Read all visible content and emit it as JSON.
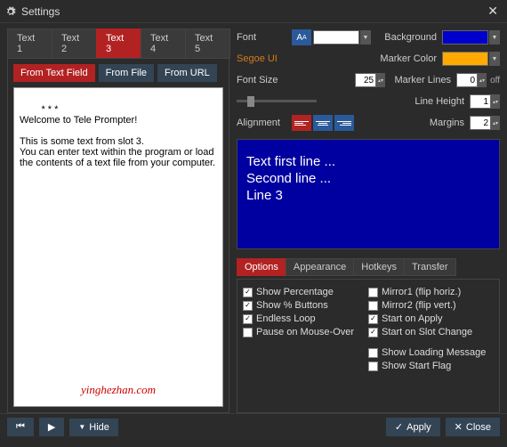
{
  "window": {
    "title": "Settings",
    "close": "✕"
  },
  "left_tabs": [
    "Text 1",
    "Text 2",
    "Text 3",
    "Text 4",
    "Text 5"
  ],
  "left_tab_active": 2,
  "src_buttons": [
    "From Text Field",
    "From File",
    "From URL"
  ],
  "src_active": 0,
  "text_content": "* * *\nWelcome to Tele Prompter!\n\nThis is some text from slot 3.\nYou can enter text within the program or load the contents of a text file from your computer.",
  "watermark": "yinghezhan.com",
  "font": {
    "label": "Font",
    "name": "Segoe UI",
    "size_label": "Font Size",
    "size": "25",
    "align_label": "Alignment"
  },
  "colors": {
    "bg_label": "Background",
    "bg": "#0000cc",
    "marker_label": "Marker Color",
    "marker": "#ffaa00",
    "lines_label": "Marker Lines",
    "lines": "0",
    "lines_off": "off",
    "lh_label": "Line Height",
    "lh": "1",
    "margins_label": "Margins",
    "margins": "2",
    "font_color": "#ffffff"
  },
  "preview": [
    "Text first line ...",
    "Second line ...",
    "Line 3"
  ],
  "opt_tabs": [
    "Options",
    "Appearance",
    "Hotkeys",
    "Transfer"
  ],
  "opt_tab_active": 0,
  "options_left": [
    {
      "label": "Show Percentage",
      "checked": true
    },
    {
      "label": "Show % Buttons",
      "checked": true
    },
    {
      "label": "Endless Loop",
      "checked": true
    },
    {
      "label": "Pause on Mouse-Over",
      "checked": false
    }
  ],
  "options_right": [
    {
      "label": "Mirror1 (flip horiz.)",
      "checked": false
    },
    {
      "label": "Mirror2 (flip vert.)",
      "checked": false
    },
    {
      "label": "Start on Apply",
      "checked": true
    },
    {
      "label": "Start on Slot Change",
      "checked": true
    }
  ],
  "options_bottom": [
    {
      "label": "Show Loading Message",
      "checked": false
    },
    {
      "label": "Show Start Flag",
      "checked": false
    }
  ],
  "footer": {
    "hide": "Hide",
    "apply": "Apply",
    "close": "Close"
  }
}
